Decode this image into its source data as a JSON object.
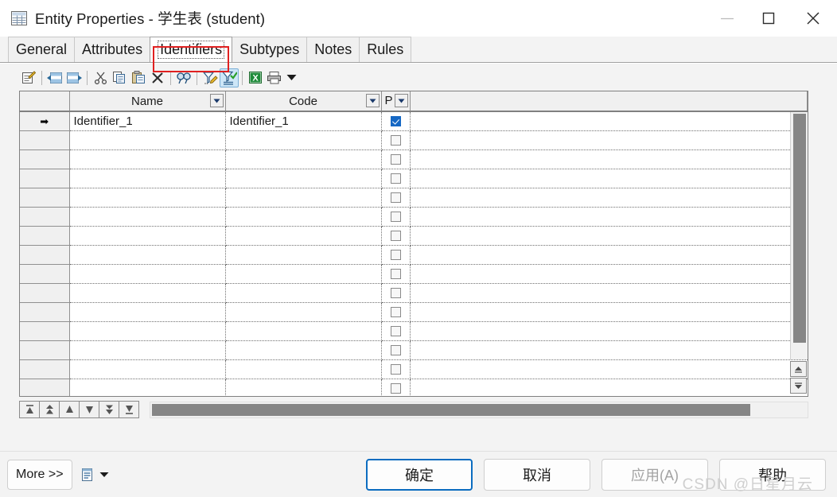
{
  "window": {
    "title": "Entity Properties - 学生表 (student)",
    "icon": "table-grid-icon",
    "controls": {
      "minimize": "minimize-icon",
      "maximize": "maximize-icon",
      "close": "close-icon"
    }
  },
  "tabs": [
    {
      "label": "General",
      "active": false
    },
    {
      "label": "Attributes",
      "active": false
    },
    {
      "label": "Identifiers",
      "active": true
    },
    {
      "label": "Subtypes",
      "active": false
    },
    {
      "label": "Notes",
      "active": false
    },
    {
      "label": "Rules",
      "active": false
    }
  ],
  "annotation": {
    "type": "red-highlight-box",
    "target": "Identifiers"
  },
  "toolbar": [
    {
      "name": "properties-icon",
      "tooltip": "Properties"
    },
    {
      "name": "insert-row-icon",
      "tooltip": "Insert a Row"
    },
    {
      "name": "add-row-icon",
      "tooltip": "Add a Row"
    },
    {
      "name": "cut-icon",
      "tooltip": "Cut"
    },
    {
      "name": "copy-icon",
      "tooltip": "Copy"
    },
    {
      "name": "paste-icon",
      "tooltip": "Paste"
    },
    {
      "name": "delete-icon",
      "tooltip": "Delete"
    },
    {
      "name": "find-icon",
      "tooltip": "Find"
    },
    {
      "name": "edit-filter-icon",
      "tooltip": "Customize Filter"
    },
    {
      "name": "apply-filter-icon",
      "tooltip": "Apply Filter",
      "active": true
    },
    {
      "name": "excel-export-icon",
      "tooltip": "Export to Excel"
    },
    {
      "name": "print-icon",
      "tooltip": "Print"
    },
    {
      "name": "toolbar-overflow-caret-icon",
      "tooltip": "More"
    }
  ],
  "grid": {
    "columns": [
      {
        "key": "rowhead",
        "label": ""
      },
      {
        "key": "name",
        "label": "Name",
        "filter": true
      },
      {
        "key": "code",
        "label": "Code",
        "filter": true
      },
      {
        "key": "p",
        "label": "P",
        "filter": true
      },
      {
        "key": "fill",
        "label": ""
      }
    ],
    "rows": [
      {
        "marker": "➡",
        "name": "Identifier_1",
        "code": "Identifier_1",
        "p": true
      },
      {
        "marker": "",
        "name": "",
        "code": "",
        "p": false
      },
      {
        "marker": "",
        "name": "",
        "code": "",
        "p": false
      },
      {
        "marker": "",
        "name": "",
        "code": "",
        "p": false
      },
      {
        "marker": "",
        "name": "",
        "code": "",
        "p": false
      },
      {
        "marker": "",
        "name": "",
        "code": "",
        "p": false
      },
      {
        "marker": "",
        "name": "",
        "code": "",
        "p": false
      },
      {
        "marker": "",
        "name": "",
        "code": "",
        "p": false
      },
      {
        "marker": "",
        "name": "",
        "code": "",
        "p": false
      },
      {
        "marker": "",
        "name": "",
        "code": "",
        "p": false
      },
      {
        "marker": "",
        "name": "",
        "code": "",
        "p": false
      },
      {
        "marker": "",
        "name": "",
        "code": "",
        "p": false
      },
      {
        "marker": "",
        "name": "",
        "code": "",
        "p": false
      },
      {
        "marker": "",
        "name": "",
        "code": "",
        "p": false
      },
      {
        "marker": "",
        "name": "",
        "code": "",
        "p": false
      }
    ]
  },
  "record_nav": [
    {
      "name": "first-record-button",
      "glyph": "first"
    },
    {
      "name": "previous-page-button",
      "glyph": "prev-page"
    },
    {
      "name": "previous-record-button",
      "glyph": "prev"
    },
    {
      "name": "next-record-button",
      "glyph": "next"
    },
    {
      "name": "next-page-button",
      "glyph": "next-page"
    },
    {
      "name": "last-record-button",
      "glyph": "last"
    }
  ],
  "footer": {
    "more_label": "More >>",
    "report_icon": "report-list-icon",
    "report_caret": "chevron-down-icon",
    "buttons": [
      {
        "label": "确定",
        "style": "primary",
        "name": "ok-button"
      },
      {
        "label": "取消",
        "style": "normal",
        "name": "cancel-button"
      },
      {
        "label": "应用(A)",
        "style": "disabled",
        "name": "apply-button"
      },
      {
        "label": "帮助",
        "style": "normal",
        "name": "help-button"
      }
    ]
  },
  "watermark": "CSDN @日星月云",
  "colors": {
    "accent": "#0b6cc0",
    "checkbox_checked": "#1668c4",
    "annotation_red": "#e02020",
    "dialog_bg": "#f3f3f3",
    "scrollbar_thumb": "#868686"
  }
}
